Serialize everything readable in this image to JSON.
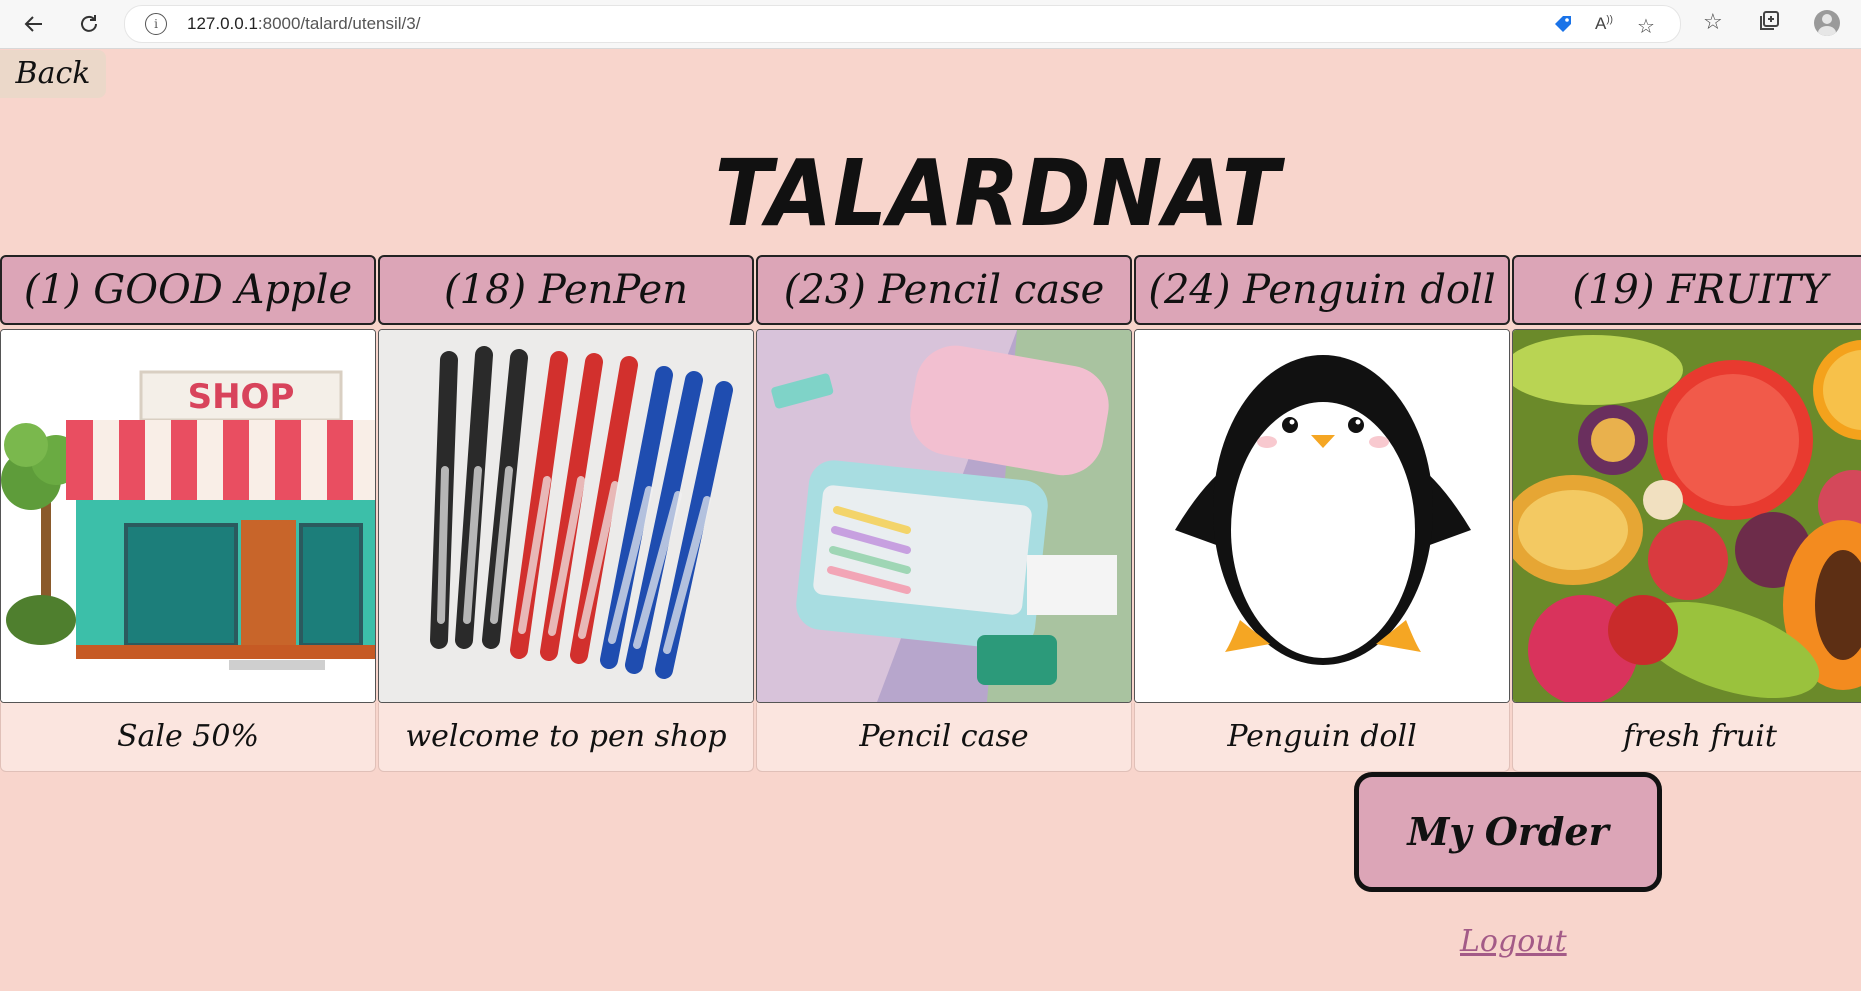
{
  "browser": {
    "url_host": "127.0.0.1",
    "url_rest": ":8000/talard/utensil/3/"
  },
  "page": {
    "back_label": "Back",
    "title": "TALARDNAT",
    "my_order_label": "My Order",
    "logout_label": "Logout"
  },
  "cards": [
    {
      "header": "(1) GOOD Apple",
      "description": "Sale 50%",
      "image": "shop-storefront"
    },
    {
      "header": "(18) PenPen",
      "description": "welcome to pen shop",
      "image": "gel-pens"
    },
    {
      "header": "(23) Pencil case",
      "description": "Pencil case",
      "image": "pencil-case"
    },
    {
      "header": "(24) Penguin doll",
      "description": "Penguin doll",
      "image": "penguin"
    },
    {
      "header": "(19) FRUITY",
      "description": "fresh fruit",
      "image": "fruits"
    }
  ],
  "shop_sign_text": "SHOP",
  "colors": {
    "background": "#f8d5cc",
    "card_header": "#dca5b7",
    "card_desc": "#fbe5df",
    "logout_link": "#a35a87",
    "back_button": "#ebd8c9"
  }
}
